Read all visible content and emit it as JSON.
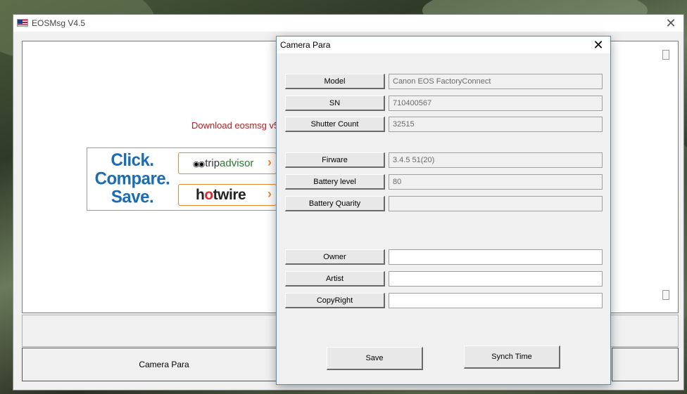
{
  "main_window": {
    "title": "EOSMsg V4.5",
    "close_glyph": "✕",
    "download_text": "Download eosmsg v5",
    "ad": {
      "headline_lines": [
        "Click.",
        "Compare.",
        "Save."
      ],
      "tripadvisor_prefix": "trip",
      "tripadvisor_name": "advisor",
      "tripadvisor_suffix": "·",
      "hotwire_h": "h",
      "hotwire_dot": "o",
      "hotwire_rest": "twire",
      "chevron": "›"
    },
    "camera_para_button": "Camera Para"
  },
  "dialog": {
    "title": "Camera Para",
    "close_glyph": "✕",
    "fields": {
      "model": {
        "label": "Model",
        "value": "Canon EOS FactoryConnect"
      },
      "sn": {
        "label": "SN",
        "value": "710400567"
      },
      "shutter_count": {
        "label": "Shutter Count",
        "value": "32515"
      },
      "firmware": {
        "label": "Firware",
        "value": "3.4.5 51(20)"
      },
      "battery_level": {
        "label": "Battery level",
        "value": "80"
      },
      "battery_quality": {
        "label": "Battery Quarity",
        "value": ""
      },
      "owner": {
        "label": "Owner",
        "value": ""
      },
      "artist": {
        "label": "Artist",
        "value": ""
      },
      "copyright": {
        "label": "CopyRight",
        "value": ""
      }
    },
    "save_button": "Save",
    "synch_time_button": "Synch Time"
  }
}
